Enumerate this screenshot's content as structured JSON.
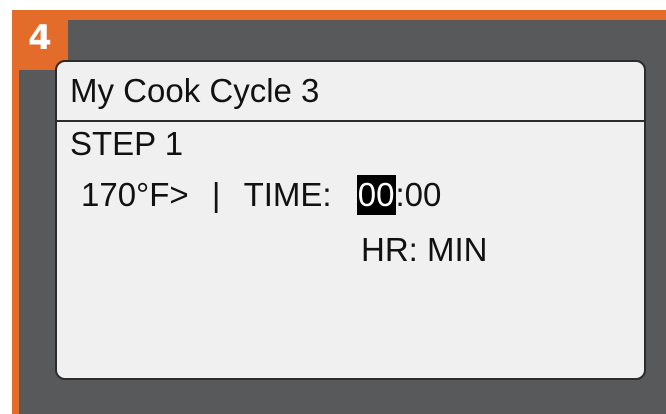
{
  "step_badge": "4",
  "colors": {
    "accent": "#e46c2a",
    "panel": "#58595b",
    "screen_bg": "#f0f0f0",
    "text": "#111111",
    "highlight_bg": "#000000",
    "highlight_text": "#ffffff"
  },
  "screen": {
    "title": "My Cook Cycle 3",
    "step_label": "STEP 1",
    "temperature": "170°F>",
    "separator": "|",
    "time_label": "TIME:",
    "time_hours": "00",
    "time_colon": ":",
    "time_minutes": "00",
    "units_label": "HR: MIN"
  }
}
